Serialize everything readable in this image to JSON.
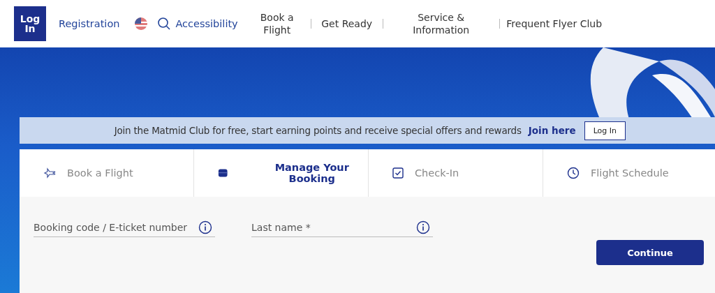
{
  "header": {
    "login": "Log In",
    "registration": "Registration",
    "accessibility": "Accessibility",
    "nav": [
      "Book a Flight",
      "Get Ready",
      "Service & Information",
      "Frequent Flyer Club"
    ]
  },
  "banner": {
    "text": "Join the Matmid Club for free, start earning points and receive special offers and rewards",
    "link": "Join here",
    "button": "Log In"
  },
  "tabs": [
    {
      "label": "Book a Flight",
      "selected": false
    },
    {
      "label": "Manage Your Booking",
      "selected": true
    },
    {
      "label": "Check-In",
      "selected": false
    },
    {
      "label": "Flight Schedule",
      "selected": false
    }
  ],
  "form": {
    "fields": [
      {
        "placeholder": "Booking code / E-ticket number"
      },
      {
        "placeholder": "Last name *"
      }
    ],
    "button": "Continue"
  }
}
